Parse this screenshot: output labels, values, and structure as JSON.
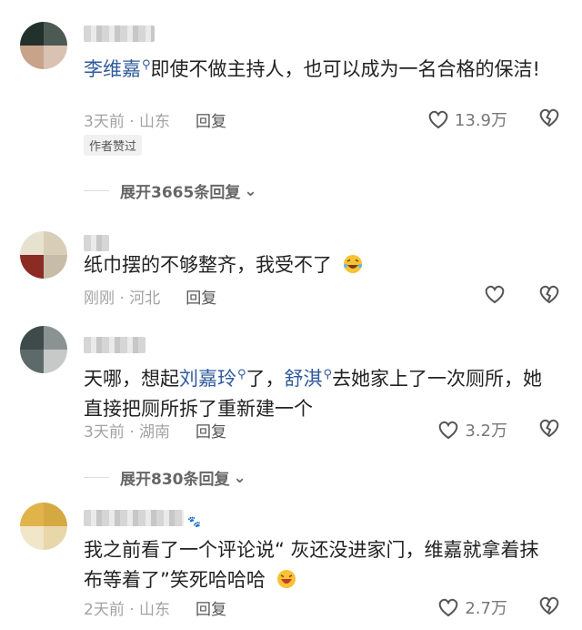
{
  "comments": [
    {
      "mention1": "李维嘉",
      "text": "即使不做主持人，也可以成为一名合格的保洁!",
      "time_loc": "3天前 · 山东",
      "reply": "回复",
      "likes": "13.9万",
      "badge": "作者赞过",
      "expand": "展开3665条回复"
    },
    {
      "text": "纸巾摆的不够整齐，我受不了",
      "time_loc": "刚刚 · 河北",
      "reply": "回复"
    },
    {
      "pre": "天哪，想起",
      "mention1": "刘嘉玲",
      "mid": "了，",
      "mention2": "舒淇",
      "post": "去她家上了一次厕所，她直接把厕所拆了重新建一个",
      "time_loc": "3天前 · 湖南",
      "reply": "回复",
      "likes": "3.2万",
      "expand": "展开830条回复"
    },
    {
      "text": "我之前看了一个评论说“ 灰还没进家门，维嘉就拿着抹布等着了”笑死哈哈哈",
      "time_loc": "2天前 · 山东",
      "reply": "回复",
      "likes": "2.7万"
    }
  ]
}
